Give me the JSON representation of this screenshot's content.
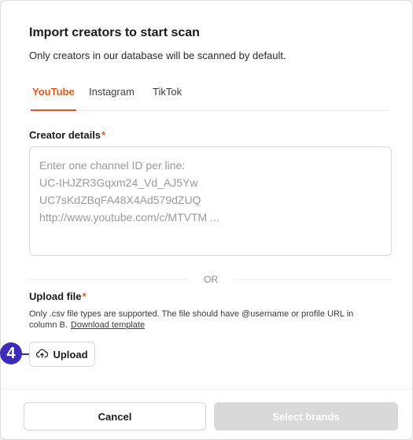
{
  "modal": {
    "title": "Import creators to start scan",
    "subtitle": "Only creators in our database will be scanned by default."
  },
  "tabs": [
    {
      "label": "YouTube",
      "active": true
    },
    {
      "label": "Instagram",
      "active": false
    },
    {
      "label": "TikTok",
      "active": false
    }
  ],
  "creator_details": {
    "label": "Creator details",
    "required_mark": "*",
    "placeholder_lines": [
      "Enter one channel ID per line:",
      "UC-IHJZR3Gqxm24_Vd_AJ5Yw",
      "UC7sKdZBqFA48X4Ad579dZUQ",
      "http://www.youtube.com/c/MTVTM ..."
    ]
  },
  "divider": {
    "text": "OR"
  },
  "upload_file": {
    "label": "Upload file",
    "required_mark": "*",
    "help_text": "Only .csv file types are supported. The file should have @username or profile URL in column B.",
    "template_link": "Download template",
    "button_label": "Upload",
    "button_icon": "cloud-upload-icon"
  },
  "step_marker": {
    "number": "4"
  },
  "footer": {
    "cancel_label": "Cancel",
    "primary_label": "Select brands",
    "primary_disabled": true
  },
  "colors": {
    "accent": "#e4571b",
    "marker": "#3b2bb8",
    "disabled_button": "#d9d9d9"
  }
}
